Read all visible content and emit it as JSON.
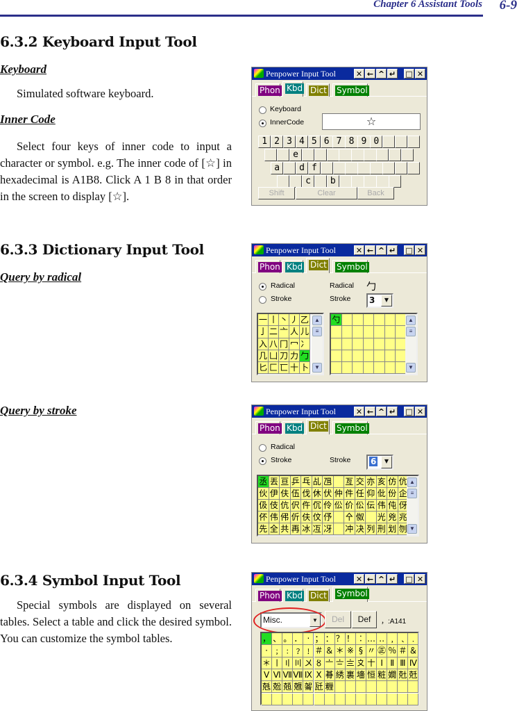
{
  "header": {
    "chapter": "Chapter 6 Assistant Tools",
    "page": "6-9"
  },
  "sections": {
    "s632": {
      "title": "6.3.2 Keyboard Input Tool",
      "keyboard_heading": "Keyboard",
      "keyboard_text": "Simulated software keyboard.",
      "inner_heading": "Inner Code",
      "inner_text": "Select four keys of inner code to input a character or symbol. e.g. The inner code of [☆] in hexadecimal is A1B8. Click  A 1 B 8 in that order in the screen to display  [☆]."
    },
    "s633": {
      "title": "6.3.3 Dictionary Input Tool",
      "radical_heading": "Query by radical",
      "stroke_heading": "Query by stroke"
    },
    "s634": {
      "title": "6.3.4 Symbol Input Tool",
      "text": "Special symbols are displayed on several tables. Select a table and click the desired symbol. You can customize the symbol tables."
    }
  },
  "window": {
    "title": "Penpower Input Tool",
    "title_buttons": [
      "✕",
      "←",
      "^",
      "↵",
      "□",
      "✕"
    ],
    "tabs": [
      {
        "label": "Phon",
        "color": "#800080"
      },
      {
        "label": "Kbd",
        "color": "#008080"
      },
      {
        "label": "Dict",
        "color": "#808000"
      },
      {
        "label": "Symbol",
        "color": "#008000"
      }
    ]
  },
  "kbd": {
    "radio_keyboard": "Keyboard",
    "radio_inner": "InnerCode",
    "display": "☆",
    "rows": [
      [
        "1",
        "2",
        "3",
        "4",
        "5",
        "6",
        "7",
        "8",
        "9",
        "0",
        "",
        "",
        ""
      ],
      [
        "",
        "",
        "e",
        "",
        "",
        "",
        "",
        "",
        "",
        "",
        "",
        ""
      ],
      [
        "a",
        "",
        "d",
        "f",
        "",
        "",
        "",
        "",
        "",
        "",
        "",
        ""
      ],
      [
        "",
        "",
        "c",
        "",
        "b",
        "",
        "",
        "",
        "",
        ""
      ]
    ],
    "shift": "Shift",
    "clear": "Clear",
    "back": "Back"
  },
  "radical": {
    "radio_radical": "Radical",
    "radio_stroke": "Stroke",
    "radical_label": "Radical",
    "radical_value": "勹",
    "stroke_label": "Stroke",
    "stroke_value": "3",
    "radicals": [
      "一",
      "丨",
      "丶",
      "丿",
      "乙",
      "亅",
      "二",
      "亠",
      "人",
      "儿",
      "入",
      "八",
      "冂",
      "冖",
      "冫",
      "几",
      "凵",
      "刀",
      "力",
      "勹",
      "匕",
      "匚",
      "匸",
      "十",
      "卜"
    ],
    "selected_radical": "勹",
    "results": [
      "勺"
    ]
  },
  "stroke": {
    "radio_radical": "Radical",
    "radio_stroke": "Stroke",
    "stroke_label": "Stroke",
    "stroke_value": "6",
    "results": [
      "丞",
      "丟",
      "亘",
      "乒",
      "乓",
      "乩",
      "乪",
      "",
      "亙",
      "交",
      "亦",
      "亥",
      "仿",
      "伉",
      "伙",
      "伊",
      "伕",
      "伍",
      "伐",
      "休",
      "伏",
      "仲",
      "件",
      "任",
      "仰",
      "仳",
      "份",
      "企",
      "伋",
      "伎",
      "伉",
      "伬",
      "仵",
      "伔",
      "伶",
      "伀",
      "价",
      "伀",
      "伝",
      "伟",
      "伅",
      "伢",
      "伓",
      "伟",
      "伄",
      "伒",
      "伕",
      "伩",
      "伃",
      "",
      "㐃",
      "伮",
      "",
      "光",
      "兇",
      "兆",
      "先",
      "全",
      "共",
      "再",
      "冰",
      "冱",
      "冴",
      "",
      "冲",
      "决",
      "列",
      "刑",
      "划",
      "刎"
    ]
  },
  "symbol": {
    "table": "Misc.",
    "del": "Del",
    "def": "Def",
    "code": "，:A141",
    "symbols": [
      "，",
      "、",
      "。",
      "．",
      "‧",
      "；",
      "：",
      "？",
      "！",
      "︰",
      "…",
      "‥",
      "﹐",
      "﹑",
      "﹒",
      "·",
      "﹔",
      "﹕",
      "﹖",
      "﹗",
      "＃",
      "＆",
      "＊",
      "※",
      "§",
      "〃",
      "㊣",
      "％",
      "＃",
      "＆",
      "＊",
      "〡",
      "〢",
      "〣",
      "〤",
      "〥",
      "〦",
      "〧",
      "〨",
      "〩",
      "〸",
      "Ⅰ",
      "Ⅱ",
      "Ⅲ",
      "Ⅳ",
      "Ⅴ",
      "Ⅵ",
      "Ⅶ",
      "Ⅷ",
      "Ⅸ",
      "Ⅹ",
      "朞",
      "綉",
      "裏",
      "墻",
      "恒",
      "粧",
      "嫺",
      "兙",
      "兛",
      "兞",
      "兝",
      "兡",
      "兣",
      "嗧",
      "瓩",
      "糎"
    ]
  },
  "colors": {
    "title_bar": "#0a2a9e",
    "cell": "#ffff88",
    "selected_cell": "#22dd22",
    "highlight_ellipse": "#e02020"
  }
}
